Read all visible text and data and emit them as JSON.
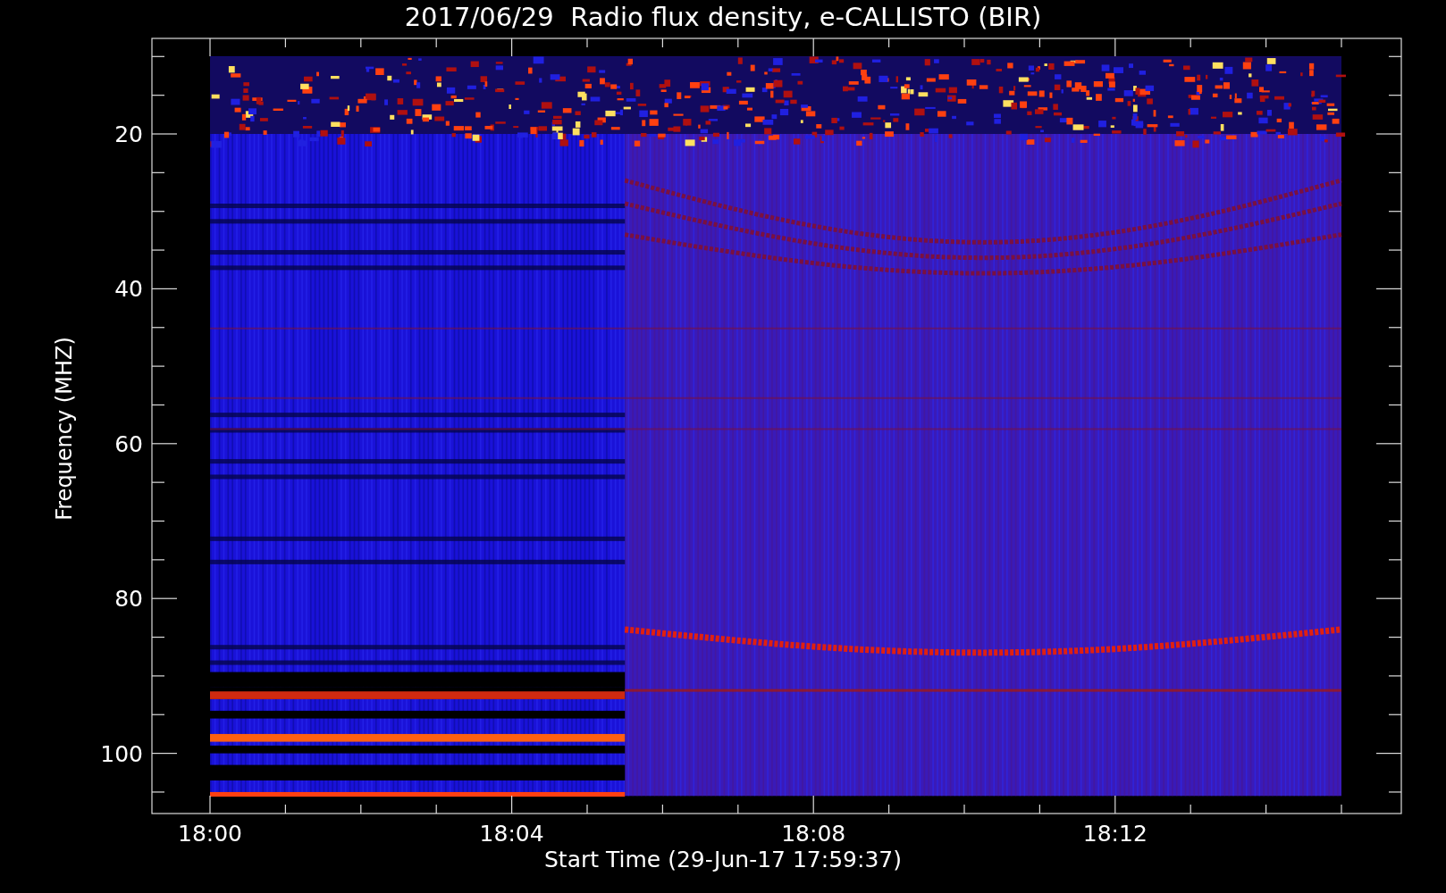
{
  "plot": {
    "title": "2017/06/29  Radio flux density, e-CALLISTO (BIR)",
    "xlabel": "Start Time (29-Jun-17 17:59:37)",
    "ylabel": "Frequency (MHZ)",
    "xticks": [
      "18:00",
      "18:04",
      "18:08",
      "18:12"
    ],
    "yticks": [
      "20",
      "40",
      "60",
      "80",
      "100"
    ]
  }
}
